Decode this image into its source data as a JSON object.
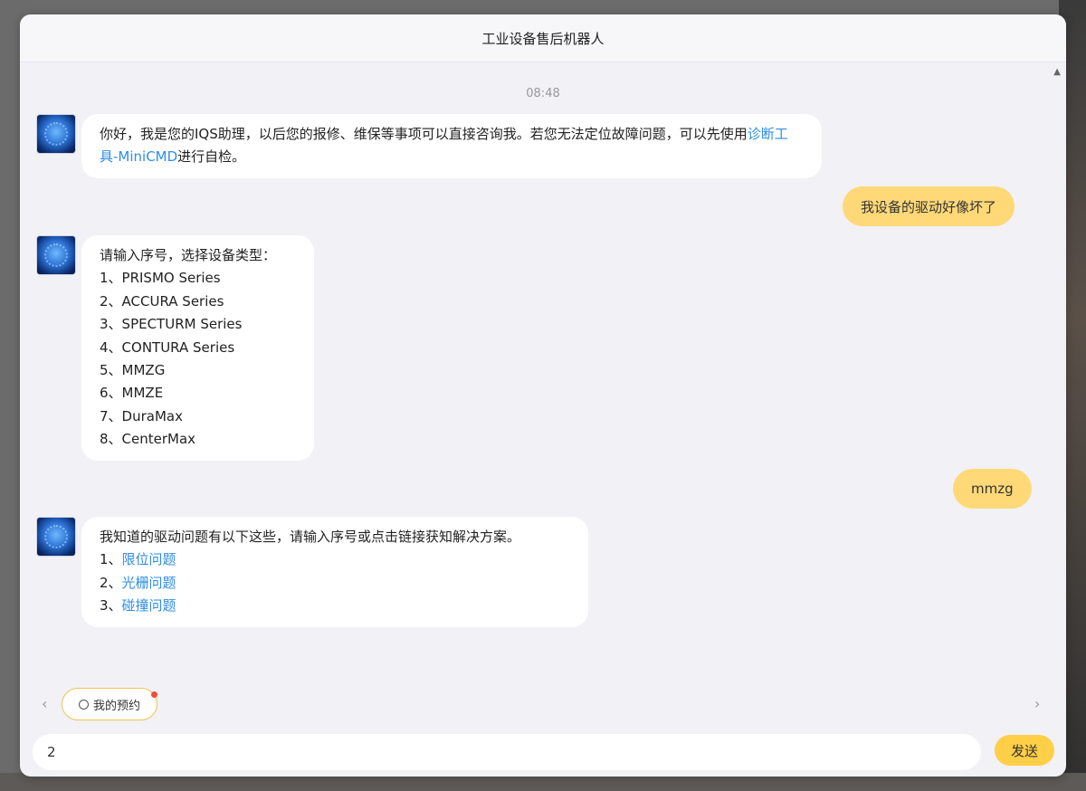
{
  "window": {
    "title": "工业设备售后机器人"
  },
  "chat": {
    "timestamp": "08:48",
    "msg1": {
      "text_before": "你好，我是您的IQS助理，以后您的报修、维保等事项可以直接咨询我。若您无法定位故障问题，可以先使用",
      "link": "诊断工具-MiniCMD",
      "text_after": "进行自检。"
    },
    "user1": "我设备的驱动好像坏了",
    "msg2": {
      "intro": "请输入序号，选择设备类型：",
      "items": [
        "1、PRISMO Series",
        "2、ACCURA Series",
        "3、SPECTURM Series",
        "4、CONTURA Series",
        "5、MMZG",
        "6、MMZE",
        "7、DuraMax",
        "8、CenterMax"
      ]
    },
    "user2": "mmzg",
    "msg3": {
      "intro": "我知道的驱动问题有以下这些，请输入序号或点击链接获知解决方案。",
      "items": [
        {
          "num": "1、",
          "label": "限位问题"
        },
        {
          "num": "2、",
          "label": "光栅问题"
        },
        {
          "num": "3、",
          "label": "碰撞问题"
        }
      ]
    }
  },
  "quick_actions": {
    "chip_label": "我的预约"
  },
  "composer": {
    "input_value": "2",
    "send_label": "发送"
  },
  "icons": {
    "scroll_up": "chevron-up-icon",
    "prev": "chevron-left-icon",
    "next": "chevron-right-icon",
    "chip": "chat-bubble-icon"
  },
  "colors": {
    "user_bubble": "#ffd978",
    "send_button": "#ffcf47",
    "link": "#2f8de4",
    "notification_dot": "#f04b3a"
  }
}
